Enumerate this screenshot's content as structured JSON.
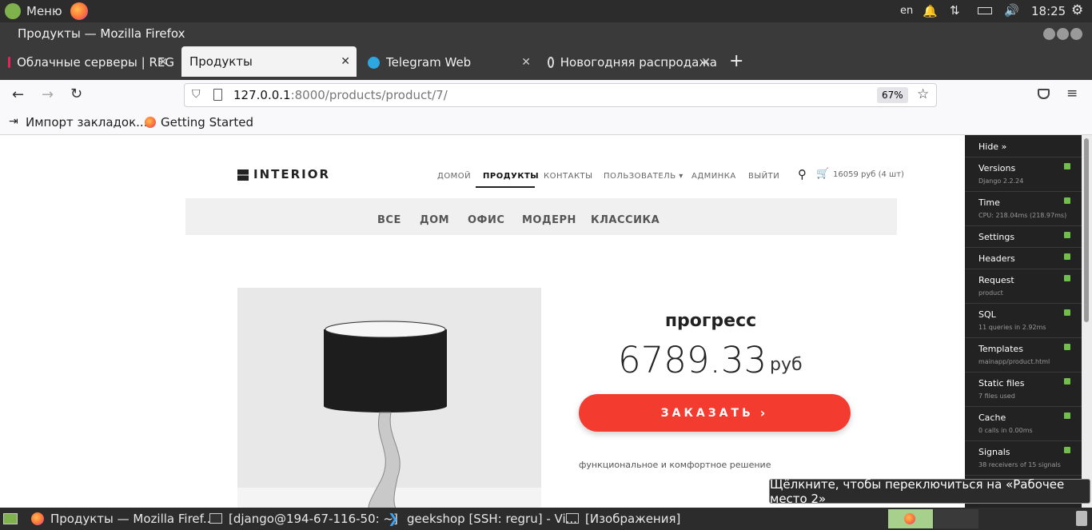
{
  "topbar": {
    "menu": "Меню",
    "lang": "en",
    "clock": "18:25"
  },
  "window": {
    "title": "Продукты — Mozilla Firefox"
  },
  "tabs": [
    {
      "label": "Облачные серверы | REG"
    },
    {
      "label": "Продукты"
    },
    {
      "label": "Telegram Web"
    },
    {
      "label": "Новогодняя распродажа"
    }
  ],
  "url": {
    "host": "127.0.0.1",
    "rest": ":8000/products/product/7/",
    "zoom": "67%"
  },
  "bookmarks": [
    {
      "label": "Импорт закладок..."
    },
    {
      "label": "Getting Started"
    }
  ],
  "site": {
    "brand": "INTERIOR",
    "menu": [
      "домой",
      "продукты",
      "контакты",
      "пользователь ▾",
      "админка",
      "выйти"
    ],
    "cart": "16059 руб (4 шт)",
    "categories": [
      "ВСЕ",
      "ДОМ",
      "ОФИС",
      "МОДЕРН",
      "КЛАССИКА"
    ],
    "product": {
      "title": "прогресс",
      "price": "6789.33",
      "currency": "руб",
      "order_label": "ЗАКАЗАТЬ",
      "description": "функциональное и комфортное решение"
    }
  },
  "djdt": {
    "hide": "Hide »",
    "panels": [
      {
        "name": "Versions",
        "sub": "Django 2.2.24"
      },
      {
        "name": "Time",
        "sub": "CPU: 218.04ms (218.97ms)"
      },
      {
        "name": "Settings",
        "sub": ""
      },
      {
        "name": "Headers",
        "sub": ""
      },
      {
        "name": "Request",
        "sub": "product"
      },
      {
        "name": "SQL",
        "sub": "11 queries in 2.92ms"
      },
      {
        "name": "Templates",
        "sub": "mainapp/product.html"
      },
      {
        "name": "Static files",
        "sub": "7 files used"
      },
      {
        "name": "Cache",
        "sub": "0 calls in 0.00ms"
      },
      {
        "name": "Signals",
        "sub": "38 receivers of 15 signals"
      }
    ]
  },
  "tooltip": "Щёлкните, чтобы переключиться на «Рабочее место 2»",
  "taskbar": [
    {
      "label": "Продукты — Mozilla Firef..."
    },
    {
      "label": "[django@194-67-116-50: ~]"
    },
    {
      "label": "geekshop [SSH: regru] - Vi..."
    },
    {
      "label": "[Изображения]"
    }
  ],
  "colors": {
    "accent": "#f33c2f",
    "dark": "#2c2c2c"
  }
}
